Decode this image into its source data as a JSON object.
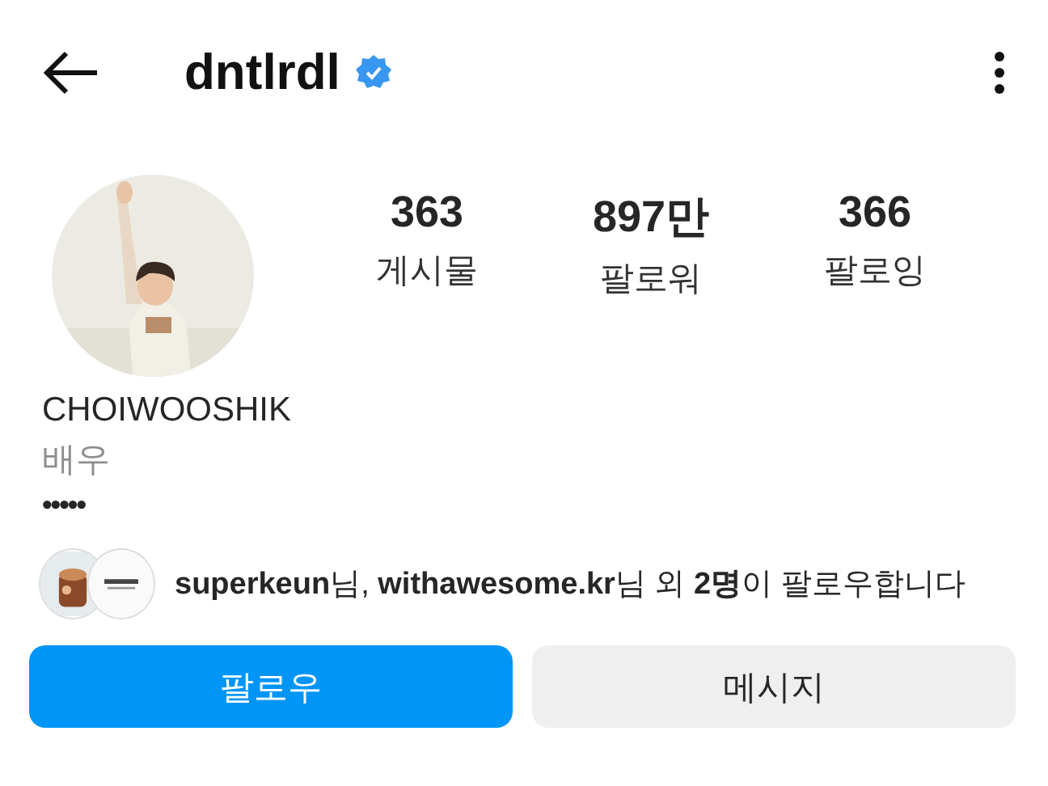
{
  "header": {
    "username": "dntlrdl",
    "verified": true
  },
  "profile": {
    "stats": [
      {
        "value": "363",
        "label": "게시물"
      },
      {
        "value": "897만",
        "label": "팔로워"
      },
      {
        "value": "366",
        "label": "팔로잉"
      }
    ],
    "name": "CHOIWOOSHIK",
    "category": "배우",
    "bio": "•••••"
  },
  "followed_by": {
    "text": "**superkeun**님, **withawesome.kr**님 외 **2명**이 팔로우합니다"
  },
  "buttons": [
    {
      "label": "팔로우",
      "kind": "primary"
    },
    {
      "label": "메시지",
      "kind": "secondary"
    }
  ]
}
